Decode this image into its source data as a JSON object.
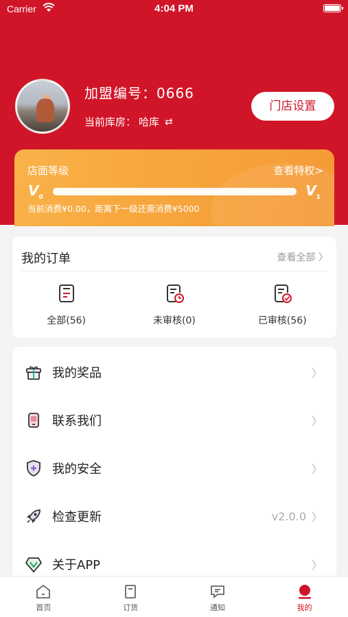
{
  "status_bar": {
    "carrier": "Carrier",
    "time": "4:04 PM"
  },
  "profile": {
    "franchise_label": "加盟编号：",
    "franchise_number": "0666",
    "warehouse_label": "当前库房：",
    "warehouse_name": "哈库",
    "store_settings_label": "门店设置"
  },
  "level": {
    "title": "店面等级",
    "view_privileges": "查看特权>",
    "current_level": "V",
    "current_level_num": "0",
    "next_level": "V",
    "next_level_num": "1",
    "progress_fraction": 0,
    "note": "当前消费¥0.00，距离下一级还需消费¥5000"
  },
  "orders": {
    "title": "我的订单",
    "view_all": "查看全部 〉",
    "items": [
      {
        "label": "全部(56)",
        "icon": "order-all-icon"
      },
      {
        "label": "未审核(0)",
        "icon": "order-pending-icon"
      },
      {
        "label": "已审核(56)",
        "icon": "order-approved-icon"
      }
    ]
  },
  "menu": [
    {
      "label": "我的奖品",
      "icon": "gift-icon"
    },
    {
      "label": "联系我们",
      "icon": "phone-icon"
    },
    {
      "label": "我的安全",
      "icon": "shield-icon"
    },
    {
      "label": "检查更新",
      "icon": "rocket-icon",
      "value": "v2.0.0"
    },
    {
      "label": "关于APP",
      "icon": "app-logo-icon"
    }
  ],
  "tabs": [
    {
      "label": "首页",
      "icon": "home-icon"
    },
    {
      "label": "订货",
      "icon": "order-goods-icon"
    },
    {
      "label": "通知",
      "icon": "message-icon"
    },
    {
      "label": "我的",
      "icon": "profile-icon",
      "active": true
    }
  ],
  "colors": {
    "brand_red": "#d11528",
    "level_orange": "#f7a73e"
  }
}
